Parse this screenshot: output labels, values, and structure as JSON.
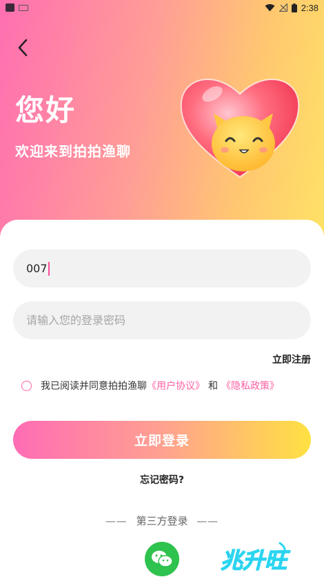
{
  "status_bar": {
    "time": "2:38",
    "icons": [
      "app-icon",
      "notification-icon",
      "wifi-icon",
      "no-signal-icon",
      "battery-icon"
    ]
  },
  "header": {
    "greeting": "您好",
    "subtitle": "欢迎来到拍拍渔聊",
    "back_icon": "chevron-left-icon",
    "mascot": "heart-cat-mascot"
  },
  "form": {
    "username_value": "007",
    "password_placeholder": "请输入您的登录密码",
    "register_label": "立即注册",
    "agree_prefix": "我已阅读并同意拍拍渔聊",
    "user_agreement": "《用户协议》",
    "agree_and": "和",
    "privacy_policy": "《隐私政策》",
    "login_label": "立即登录",
    "forgot_label": "忘记密码?"
  },
  "third_party": {
    "title": "第三方登录",
    "dash": "——",
    "providers": [
      "wechat-icon"
    ]
  },
  "watermark_text": "兆升旺",
  "colors": {
    "accent_pink": "#ff5fa3",
    "gradient_start": "#ff6fb1",
    "gradient_end": "#ffe266",
    "wechat_green": "#2ec24e"
  }
}
